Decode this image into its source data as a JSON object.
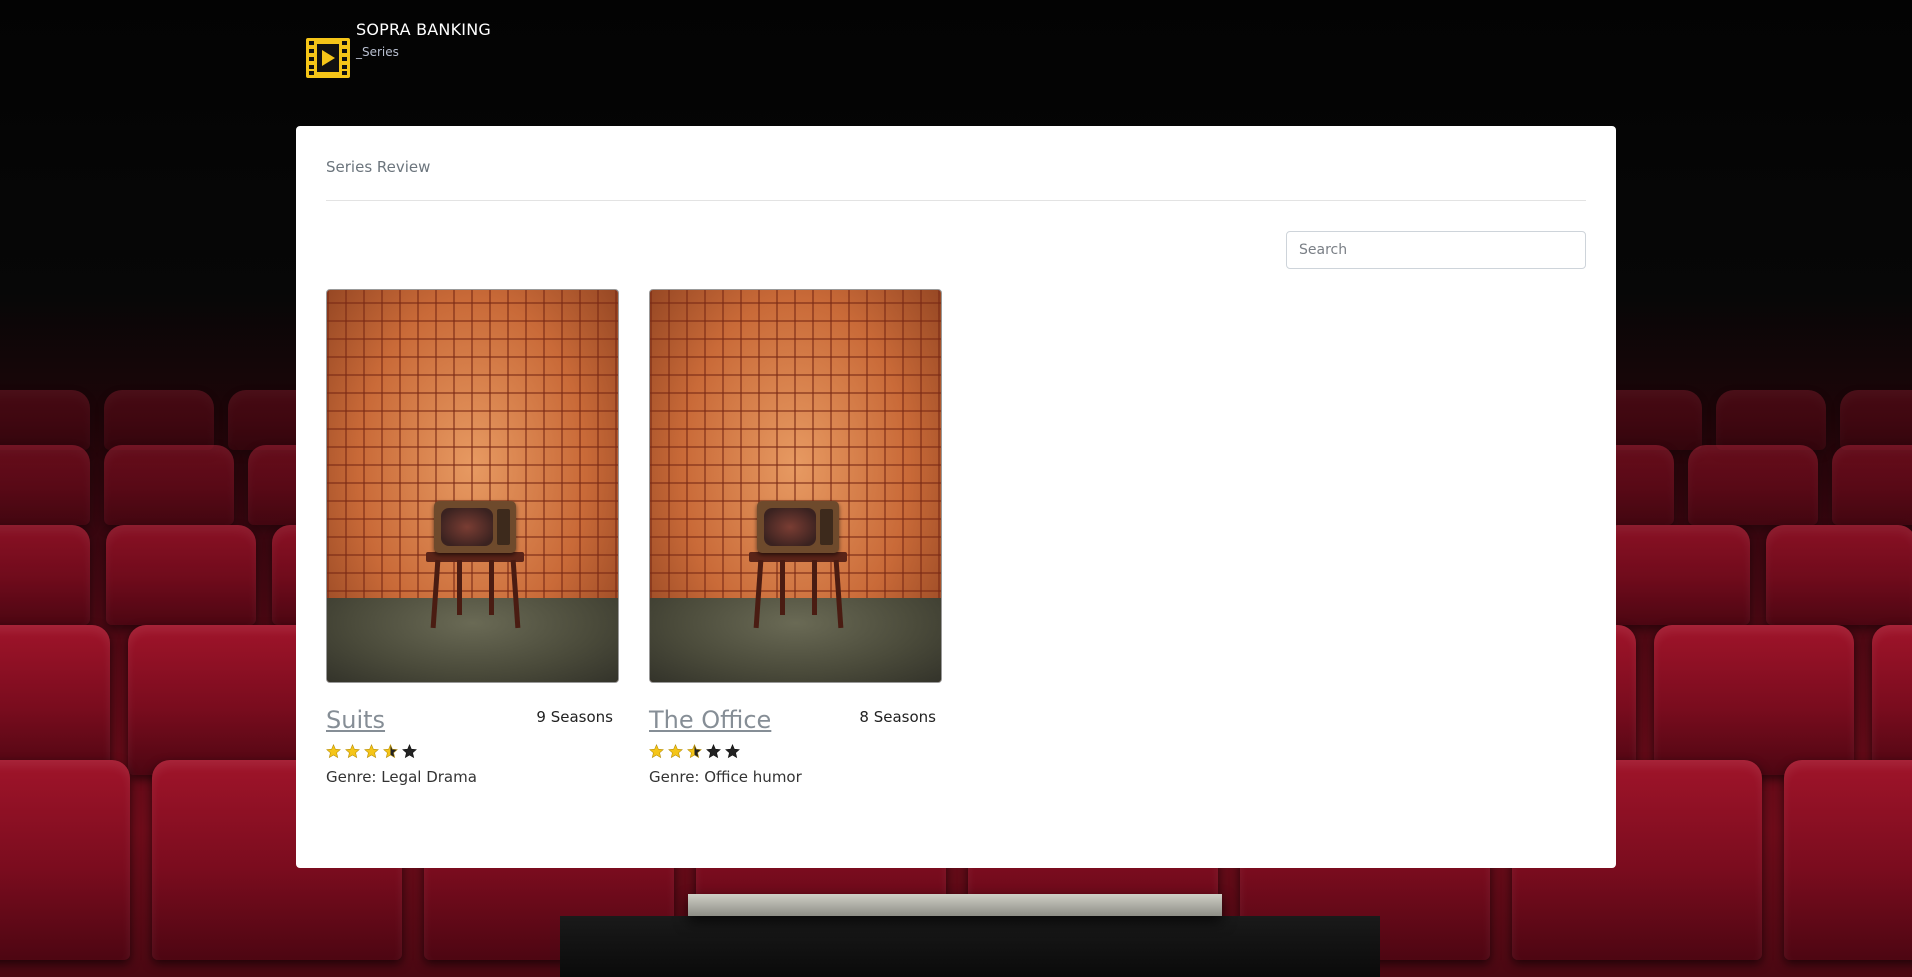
{
  "header": {
    "brand_title": "SOPRA BANKING",
    "brand_subtitle": "_Series",
    "logo_icon": "film-play-icon",
    "logo_color": "#f5c518"
  },
  "card": {
    "title": "Series Review",
    "search_placeholder": "Search",
    "search_value": ""
  },
  "series": [
    {
      "title": "Suits",
      "seasons": "9 Seasons",
      "rating": 3.5,
      "rating_max": 5,
      "genre": "Genre: Legal Drama"
    },
    {
      "title": "The Office",
      "seasons": "8 Seasons",
      "rating": 2.5,
      "rating_max": 5,
      "genre": "Genre: Office humor"
    }
  ],
  "colors": {
    "star_filled": "#f5c518",
    "star_empty": "#222222",
    "link": "#868e96"
  }
}
